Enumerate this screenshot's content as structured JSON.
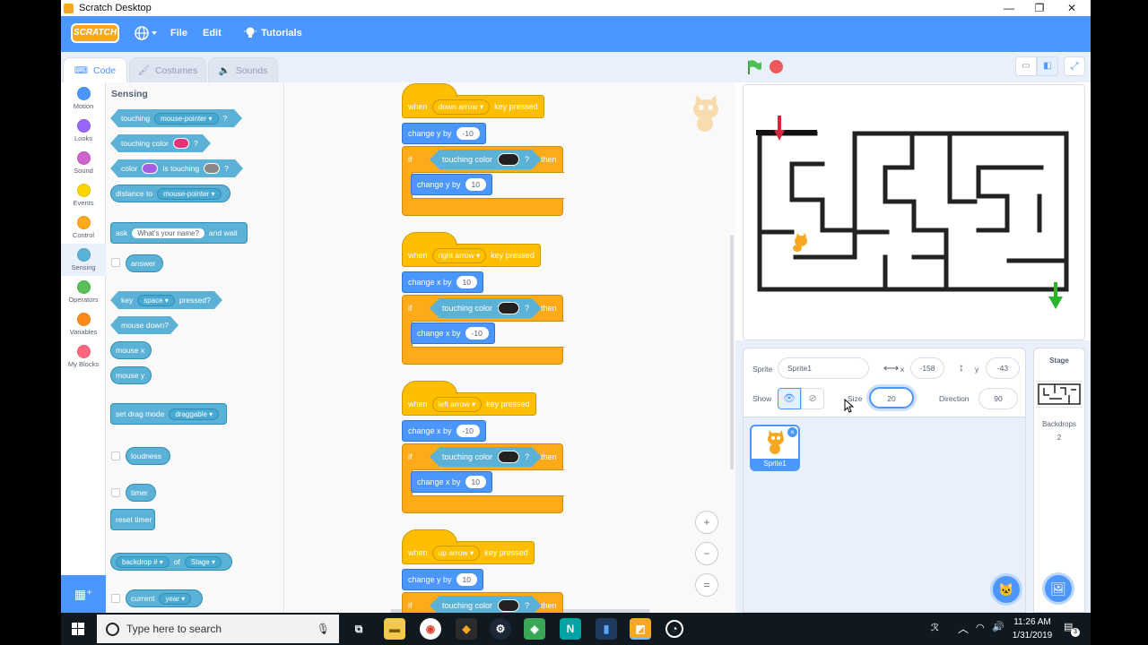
{
  "window": {
    "title": "Scratch Desktop",
    "minimize": "—",
    "maximize": "❐",
    "close": "✕"
  },
  "menu": {
    "logo": "SCRATCH",
    "file": "File",
    "edit": "Edit",
    "tutorials": "Tutorials",
    "globe_icon": "globe-icon"
  },
  "tabs": {
    "code": "Code",
    "costumes": "Costumes",
    "sounds": "Sounds"
  },
  "categories": [
    {
      "label": "Motion",
      "color": "#4c97ff"
    },
    {
      "label": "Looks",
      "color": "#9966ff"
    },
    {
      "label": "Sound",
      "color": "#cf63cf"
    },
    {
      "label": "Events",
      "color": "#ffd500"
    },
    {
      "label": "Control",
      "color": "#ffab19"
    },
    {
      "label": "Sensing",
      "color": "#5cb1d6"
    },
    {
      "label": "Operators",
      "color": "#59c059"
    },
    {
      "label": "Variables",
      "color": "#ff8c1a"
    },
    {
      "label": "My Blocks",
      "color": "#ff6680"
    }
  ],
  "palette": {
    "title": "Sensing",
    "touching": "touching",
    "mouse_pointer": "mouse-pointer ▾",
    "q": "?",
    "touching_color": "touching color",
    "color": "color",
    "is_touching": "is touching",
    "distance_to": "distance to",
    "distance_target": "mouse-pointer ▾",
    "ask": "ask",
    "ask_default": "What's your name?",
    "and_wait": "and wait",
    "answer": "answer",
    "key": "key",
    "space": "space ▾",
    "pressed": "pressed?",
    "mouse_down": "mouse down?",
    "mouse_x": "mouse x",
    "mouse_y": "mouse y",
    "set_drag_mode": "set drag mode",
    "draggable": "draggable ▾",
    "loudness": "loudness",
    "timer": "timer",
    "reset_timer": "reset timer",
    "backdrop": "backdrop # ▾",
    "of": "of",
    "stage": "Stage ▾",
    "current": "current",
    "year": "year ▾"
  },
  "scripts": [
    {
      "key": "down arrow ▾",
      "axis": "y",
      "first": "-10",
      "second": "10"
    },
    {
      "key": "right arrow ▾",
      "axis": "x",
      "first": "10",
      "second": "-10"
    },
    {
      "key": "left arrow ▾",
      "axis": "x",
      "first": "-10",
      "second": "10"
    },
    {
      "key": "up arrow ▾",
      "axis": "y",
      "first": "10",
      "second": ""
    }
  ],
  "script_text": {
    "when": "when",
    "key_pressed": "key pressed",
    "change_x_by": "change x by",
    "change_y_by": "change y by",
    "if": "if",
    "then": "then",
    "touching_color": "touching color",
    "q": "?"
  },
  "zoom": {
    "in": "+",
    "out": "−",
    "reset": "="
  },
  "sprite_info": {
    "sprite_label": "Sprite",
    "sprite_name": "Sprite1",
    "x_label": "x",
    "x": "-158",
    "y_label": "y",
    "y": "-43",
    "show_label": "Show",
    "size_label": "Size",
    "size": "20",
    "direction_label": "Direction",
    "direction": "90"
  },
  "sprites": [
    {
      "name": "Sprite1"
    }
  ],
  "stage_panel": {
    "title": "Stage",
    "backdrops_label": "Backdrops",
    "backdrops_count": "2"
  },
  "taskbar": {
    "search_placeholder": "Type here to search",
    "time": "11:26 AM",
    "date": "1/31/2019",
    "notifications": "3"
  }
}
